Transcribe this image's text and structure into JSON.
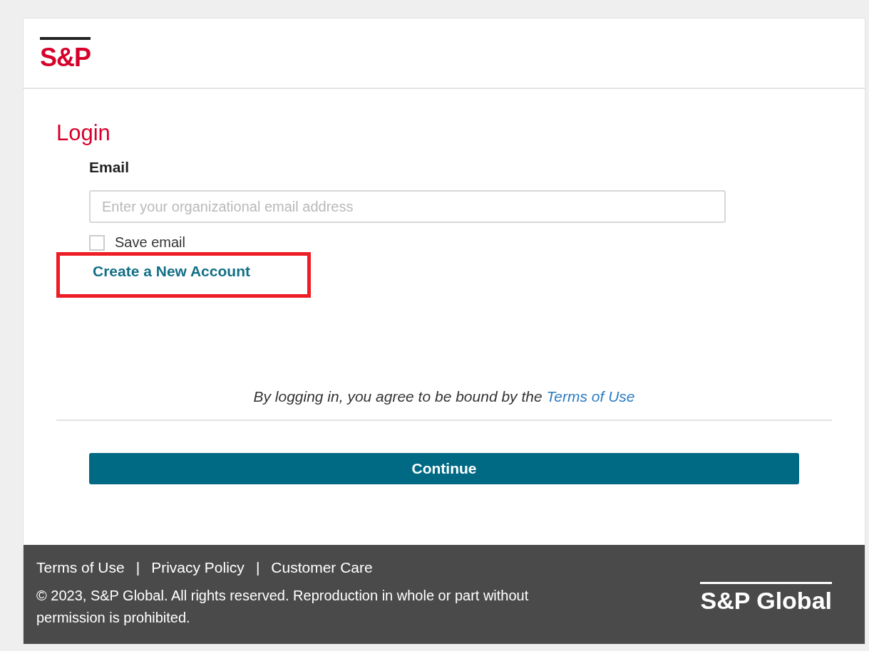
{
  "header": {
    "logo": "S&P"
  },
  "login": {
    "title": "Login",
    "email": {
      "label": "Email",
      "placeholder": "Enter your organizational email address"
    },
    "save_email": {
      "label": "Save email",
      "checked": false
    },
    "create_account": {
      "label": "Create a New Account",
      "highlighted": true
    },
    "agreement": {
      "text": "By logging in, you agree to be bound by the ",
      "link": "Terms of Use"
    },
    "button": "Continue"
  },
  "footer": {
    "links": [
      {
        "label": "Terms of Use"
      },
      {
        "label": "Privacy Policy"
      },
      {
        "label": "Customer Care"
      }
    ],
    "separators": [
      "|",
      "|"
    ],
    "copyright": "© 2023, S&P Global. All rights reserved. Reproduction in whole or part without permission is prohibited.",
    "logo": "S&P Global"
  }
}
